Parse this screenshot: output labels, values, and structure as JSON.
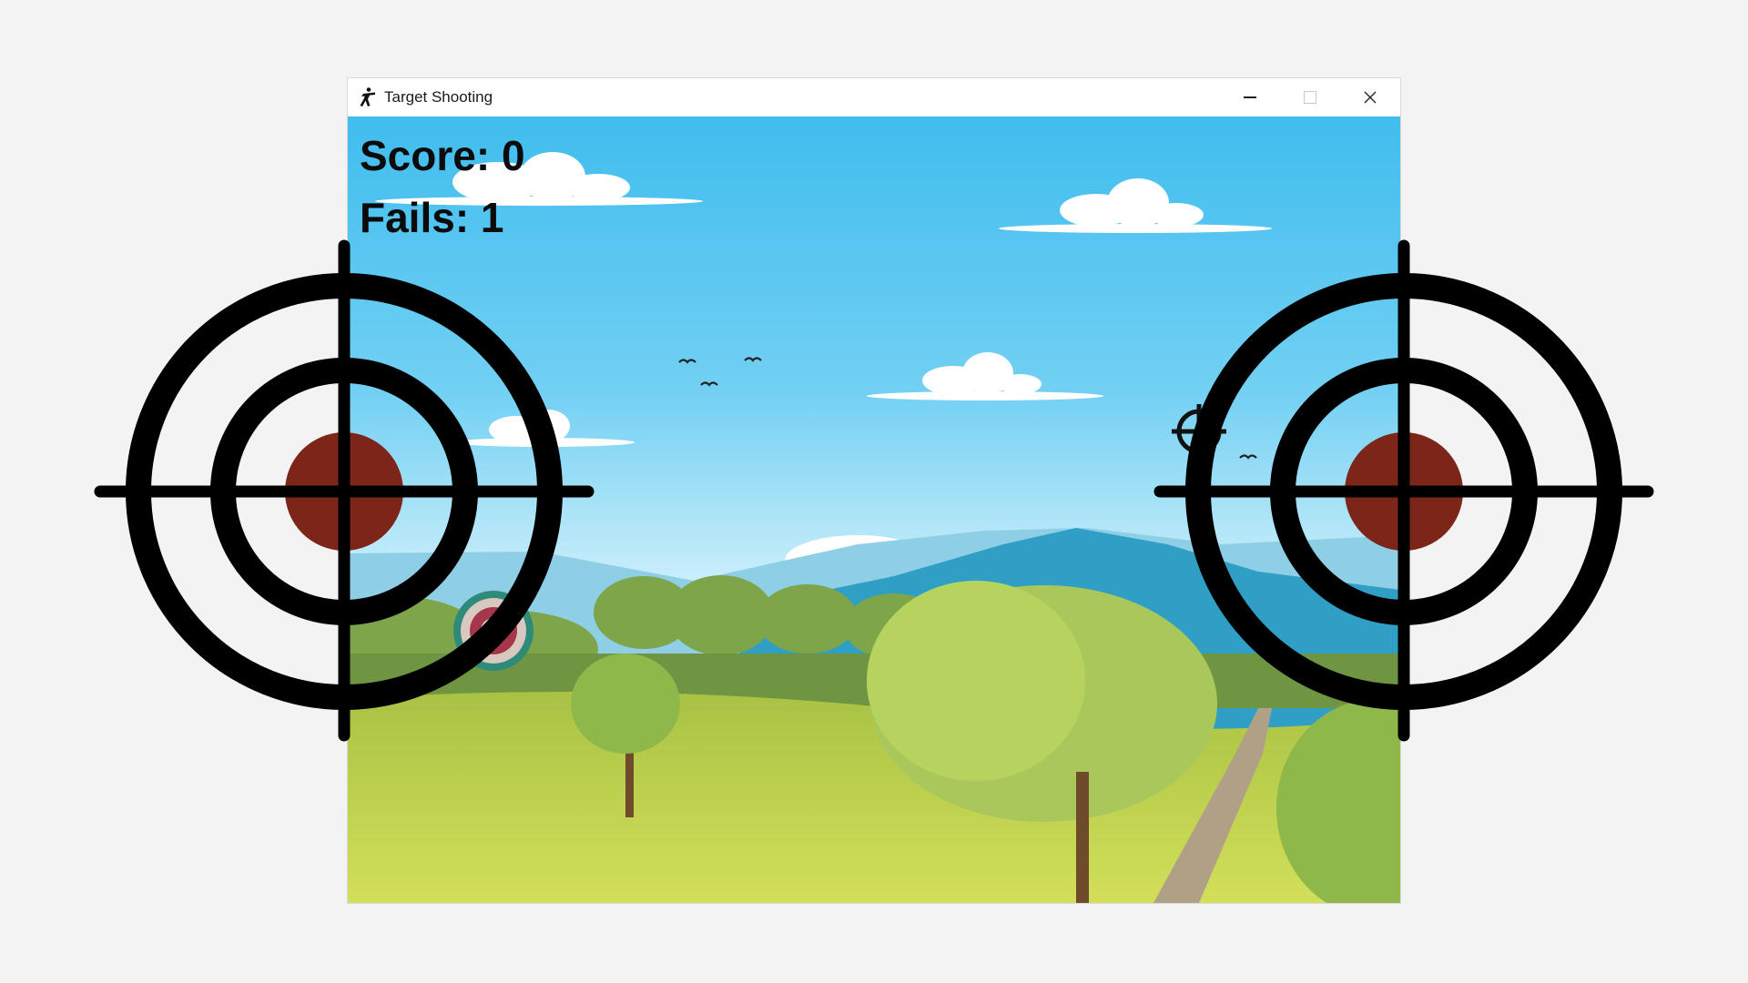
{
  "window": {
    "title": "Target Shooting",
    "controls": {
      "minimize_icon": "minimize-icon",
      "maximize_icon": "maximize-icon",
      "close_icon": "close-icon"
    }
  },
  "hud": {
    "score_text": "Score: 0",
    "fails_text": "Fails: 1",
    "score": 0,
    "fails": 1
  },
  "colors": {
    "sky_top": "#40bdee",
    "sky_bottom": "#d5f2fb",
    "mountain": "#2f9fc6",
    "grass": "#c6d64f",
    "tree_green": "#9ec14a",
    "target_center": "#7d2519",
    "crosshair": "#000000"
  },
  "icons": {
    "app": "shooter-icon",
    "crosshair": "crosshair-icon",
    "dartboard": "dartboard-target-icon",
    "bird": "bird-icon"
  }
}
